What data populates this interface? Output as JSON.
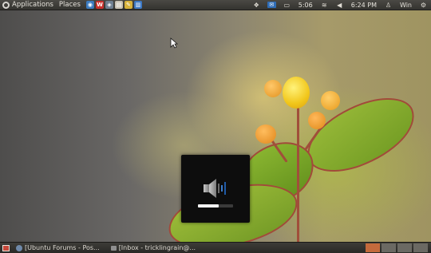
{
  "top_panel": {
    "menus": [
      "Applications",
      "Places"
    ],
    "launchers": [
      {
        "name": "firefox",
        "color": "#3b7bbf",
        "glyph": "◉"
      },
      {
        "name": "wikipedia",
        "color": "#c9302c",
        "glyph": "W"
      },
      {
        "name": "network",
        "color": "#6f7f90",
        "glyph": "◈"
      },
      {
        "name": "folder",
        "color": "#c9c2b3",
        "glyph": "▤"
      },
      {
        "name": "editor",
        "color": "#d8b23a",
        "glyph": "✎"
      },
      {
        "name": "document",
        "color": "#3c78c4",
        "glyph": "▥"
      }
    ],
    "tray": {
      "battery_time": "5:06",
      "clock": "6:24 PM",
      "user": "Win"
    }
  },
  "taskbar": {
    "tasks": [
      {
        "label": "[Ubuntu Forums - Pos..."
      },
      {
        "label": "[Inbox - tricklingrain@..."
      }
    ]
  },
  "volume_osd": {
    "level": 0.58
  },
  "colors": {
    "workspace_active": "#c46a3c",
    "workspace_inactive": "#6b6963"
  }
}
